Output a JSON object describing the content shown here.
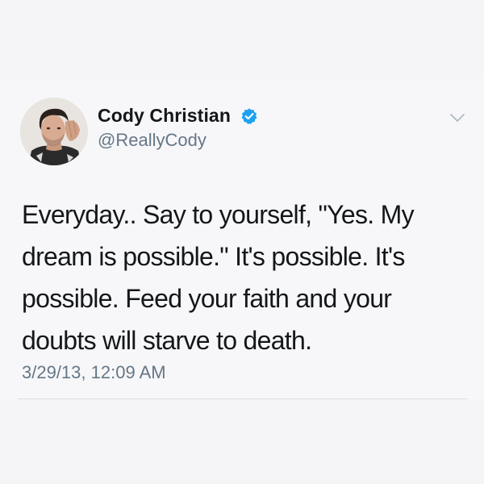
{
  "tweet": {
    "display_name": "Cody Christian",
    "handle": "@ReallyCody",
    "verified": true,
    "text": "Everyday.. Say to yourself, \"Yes. My dream is possible.\" It's possible. It's possible. Feed your faith and your doubts will starve to death.",
    "timestamp": "3/29/13, 12:09 AM"
  },
  "icons": {
    "avatar": "avatar-photo",
    "verified": "verified-badge-icon",
    "menu": "chevron-down-icon"
  },
  "colors": {
    "background": "#f7f7f9",
    "text_primary": "#14171a",
    "text_secondary": "#657786",
    "verified_blue": "#1da1f2",
    "divider": "#dcdde0"
  }
}
